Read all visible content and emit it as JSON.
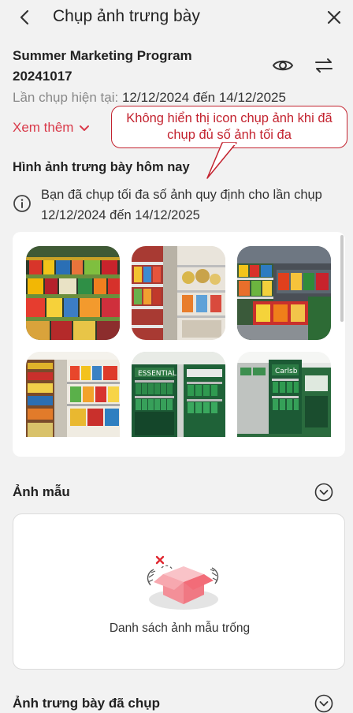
{
  "header": {
    "title": "Chụp ảnh trưng bày",
    "back_icon": "chevron-left-icon",
    "close_icon": "close-icon"
  },
  "program": {
    "name": "Summer Marketing Program 20241017",
    "period_label": "Lần chụp hiện tại:",
    "period_value": "12/12/2024 đến 14/12/2025",
    "see_more": "Xem thêm",
    "eye_icon": "eye-icon",
    "swap_icon": "swap-arrows-icon"
  },
  "annotation": {
    "text": "Không hiển thị icon chụp ảnh khi đã chụp đủ số ảnh tối đa",
    "color": "#c3232f"
  },
  "today": {
    "title": "Hình ảnh trưng bày hôm nay",
    "info": "Bạn đã chụp tối đa số ảnh quy định cho lần chụp 12/12/2024 đến 14/12/2025",
    "photos": [
      {
        "name": "shelf-photo-1",
        "theme": "snacks"
      },
      {
        "name": "shelf-photo-2",
        "theme": "aisle"
      },
      {
        "name": "shelf-photo-3",
        "theme": "store"
      },
      {
        "name": "shelf-photo-4",
        "theme": "grocery"
      },
      {
        "name": "shelf-photo-5",
        "theme": "beer-display"
      },
      {
        "name": "shelf-photo-6",
        "theme": "beer-store"
      }
    ]
  },
  "samples": {
    "title": "Ảnh mẫu",
    "empty_text": "Danh sách ảnh mẫu trống"
  },
  "taken": {
    "title": "Ảnh trưng bày đã chụp"
  },
  "colors": {
    "accent": "#d93a4a",
    "background": "#f2f2f2"
  }
}
